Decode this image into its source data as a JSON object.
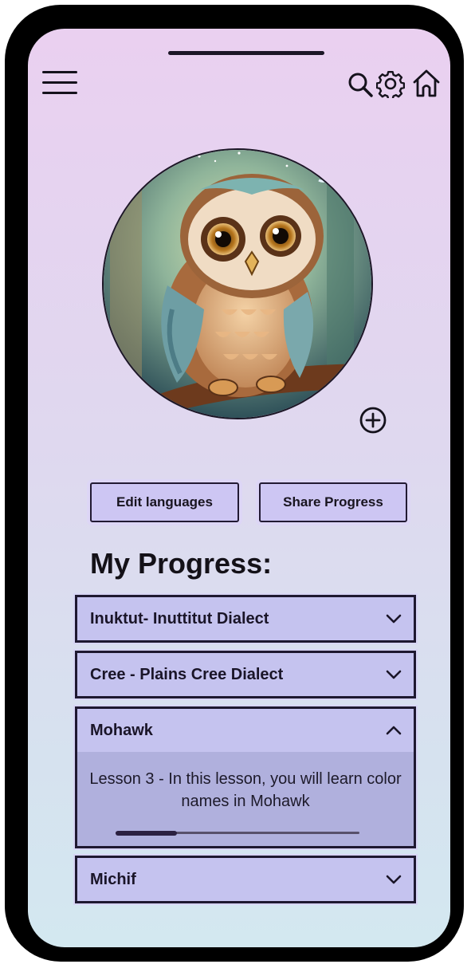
{
  "header": {
    "menu_icon": "hamburger-menu-icon",
    "search_icon": "search-icon",
    "settings_icon": "gear-icon",
    "home_icon": "home-icon"
  },
  "profile": {
    "avatar": "owl-avatar-illustration",
    "add_icon": "plus-circle-icon"
  },
  "actions": {
    "edit_languages": "Edit languages",
    "share_progress": "Share Progress"
  },
  "progress": {
    "title": "My Progress:",
    "languages": [
      {
        "label": "Inuktut- Inuttitut Dialect",
        "expanded": false
      },
      {
        "label": "Cree - Plains Cree Dialect",
        "expanded": false
      },
      {
        "label": "Mohawk",
        "expanded": true,
        "lesson": "Lesson 3 - In this lesson, you will learn color names in Mohawk",
        "progress_fraction": 0.25
      },
      {
        "label": "Michif",
        "expanded": false
      }
    ]
  },
  "colors": {
    "accent": "#cdc6f3",
    "accordion": "#c5c3ef",
    "expanded_body": "#b0b0dd",
    "outline": "#1e1830"
  }
}
